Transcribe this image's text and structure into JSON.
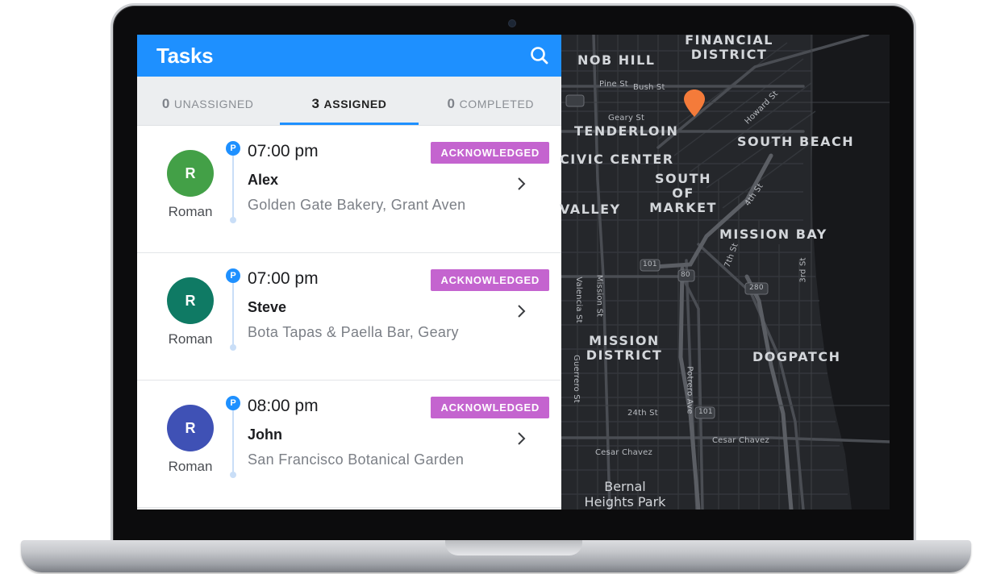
{
  "app": {
    "title": "Tasks",
    "accent_color": "#1e90ff"
  },
  "header": {
    "search_icon": "search-icon"
  },
  "tabs": [
    {
      "count": "0",
      "label": "UNASSIGNED",
      "active": false
    },
    {
      "count": "3",
      "label": "ASSIGNED",
      "active": true
    },
    {
      "count": "0",
      "label": "COMPLETED",
      "active": false
    }
  ],
  "tasks": [
    {
      "avatar_initial": "R",
      "avatar_color": "#43a047",
      "agent": "Roman",
      "pin_letter": "P",
      "time": "07:00 pm",
      "status": "ACKNOWLEDGED",
      "customer": "Alex",
      "address": "Golden Gate Bakery, Grant Aven"
    },
    {
      "avatar_initial": "R",
      "avatar_color": "#0f7a64",
      "agent": "Roman",
      "pin_letter": "P",
      "time": "07:00 pm",
      "status": "ACKNOWLEDGED",
      "customer": "Steve",
      "address": "Bota Tapas & Paella Bar, Geary"
    },
    {
      "avatar_initial": "R",
      "avatar_color": "#3f51b5",
      "agent": "Roman",
      "pin_letter": "P",
      "time": "08:00 pm",
      "status": "ACKNOWLEDGED",
      "customer": "John",
      "address": "San Francisco Botanical Garden"
    }
  ],
  "status_color": "#c464cf",
  "map": {
    "marker_color": "#f47b3a",
    "neighborhoods": [
      "FINANCIAL DISTRICT",
      "NOB HILL",
      "TENDERLOIN",
      "SOUTH BEACH",
      "CIVIC CENTER",
      "SOUTH OF MARKET",
      "VALLEY",
      "MISSION BAY",
      "MISSION DISTRICT",
      "DOGPATCH"
    ],
    "streets": [
      "Pine St",
      "Bush St",
      "Geary St",
      "Howard St",
      "4th St",
      "7th St",
      "3rd St",
      "Valencia St",
      "Mission St",
      "Guerrero St",
      "Potrero Ave",
      "24th St",
      "Cesar Chavez",
      "Cesar Chavez"
    ],
    "highways": [
      "101",
      "80",
      "280",
      "101"
    ],
    "park": "Bernal Heights Park"
  }
}
